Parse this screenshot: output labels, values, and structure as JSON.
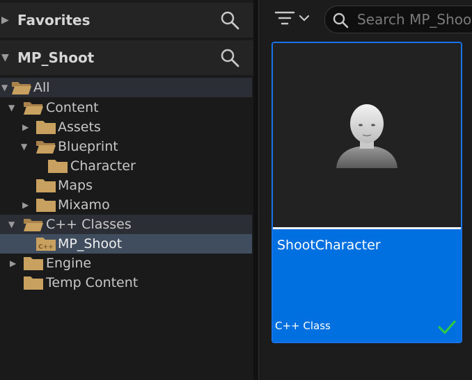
{
  "sidebar": {
    "favorites": {
      "title": "Favorites"
    },
    "project": {
      "title": "MP_Shoot"
    },
    "tree": [
      {
        "label": "All"
      },
      {
        "label": "Content"
      },
      {
        "label": "Assets"
      },
      {
        "label": "Blueprint"
      },
      {
        "label": "Character"
      },
      {
        "label": "Maps"
      },
      {
        "label": "Mixamo"
      },
      {
        "label": "C++ Classes"
      },
      {
        "label": "MP_Shoot"
      },
      {
        "label": "Engine"
      },
      {
        "label": "Temp Content"
      }
    ]
  },
  "content": {
    "search": {
      "placeholder": "Search MP_Shoot"
    },
    "asset": {
      "name": "ShootCharacter",
      "type": "C++ Class"
    }
  },
  "colors": {
    "accent": "#0070e0",
    "folder": "#c8a060",
    "check": "#2ecc40"
  }
}
